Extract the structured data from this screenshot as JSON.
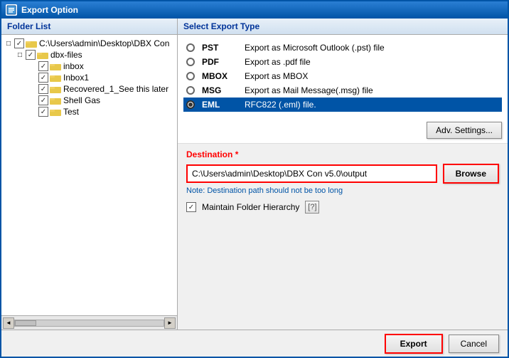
{
  "window": {
    "title": "Export Option",
    "icon": "export-icon"
  },
  "left_panel": {
    "header": "Folder List",
    "tree": [
      {
        "id": "root",
        "label": "C:\\Users\\admin\\Desktop\\DBX Con",
        "indent": 1,
        "checked": true,
        "expanded": true,
        "type": "drive"
      },
      {
        "id": "dbx-files",
        "label": "dbx-files",
        "indent": 2,
        "checked": true,
        "expanded": true,
        "type": "folder"
      },
      {
        "id": "inbox",
        "label": "inbox",
        "indent": 4,
        "checked": true,
        "type": "folder"
      },
      {
        "id": "inbox1",
        "label": "Inbox1",
        "indent": 4,
        "checked": true,
        "type": "folder"
      },
      {
        "id": "recovered",
        "label": "Recovered_1_See this later",
        "indent": 4,
        "checked": true,
        "type": "folder"
      },
      {
        "id": "shellgas",
        "label": "Shell Gas",
        "indent": 4,
        "checked": true,
        "type": "folder"
      },
      {
        "id": "test",
        "label": "Test",
        "indent": 4,
        "checked": true,
        "type": "folder"
      }
    ]
  },
  "right_panel": {
    "header": "Select Export Type",
    "export_types": [
      {
        "id": "pst",
        "name": "PST",
        "desc": "Export as Microsoft Outlook (.pst) file",
        "selected": false
      },
      {
        "id": "pdf",
        "name": "PDF",
        "desc": "Export as .pdf file",
        "selected": false
      },
      {
        "id": "mbox",
        "name": "MBOX",
        "desc": "Export as MBOX",
        "selected": false
      },
      {
        "id": "msg",
        "name": "MSG",
        "desc": "Export as Mail Message(.msg) file",
        "selected": false
      },
      {
        "id": "eml",
        "name": "EML",
        "desc": "RFC822 (.eml) file.",
        "selected": true
      }
    ],
    "adv_settings_label": "Adv. Settings...",
    "destination": {
      "label": "Destination",
      "required_marker": "*",
      "value": "C:\\Users\\admin\\Desktop\\DBX Con v5.0\\output",
      "note": "Note: Destination path should not be too long",
      "browse_label": "Browse"
    },
    "maintain_hierarchy": {
      "label": "Maintain Folder Hierarchy",
      "checked": true,
      "help_label": "[?]"
    }
  },
  "bottom_bar": {
    "export_label": "Export",
    "cancel_label": "Cancel"
  }
}
